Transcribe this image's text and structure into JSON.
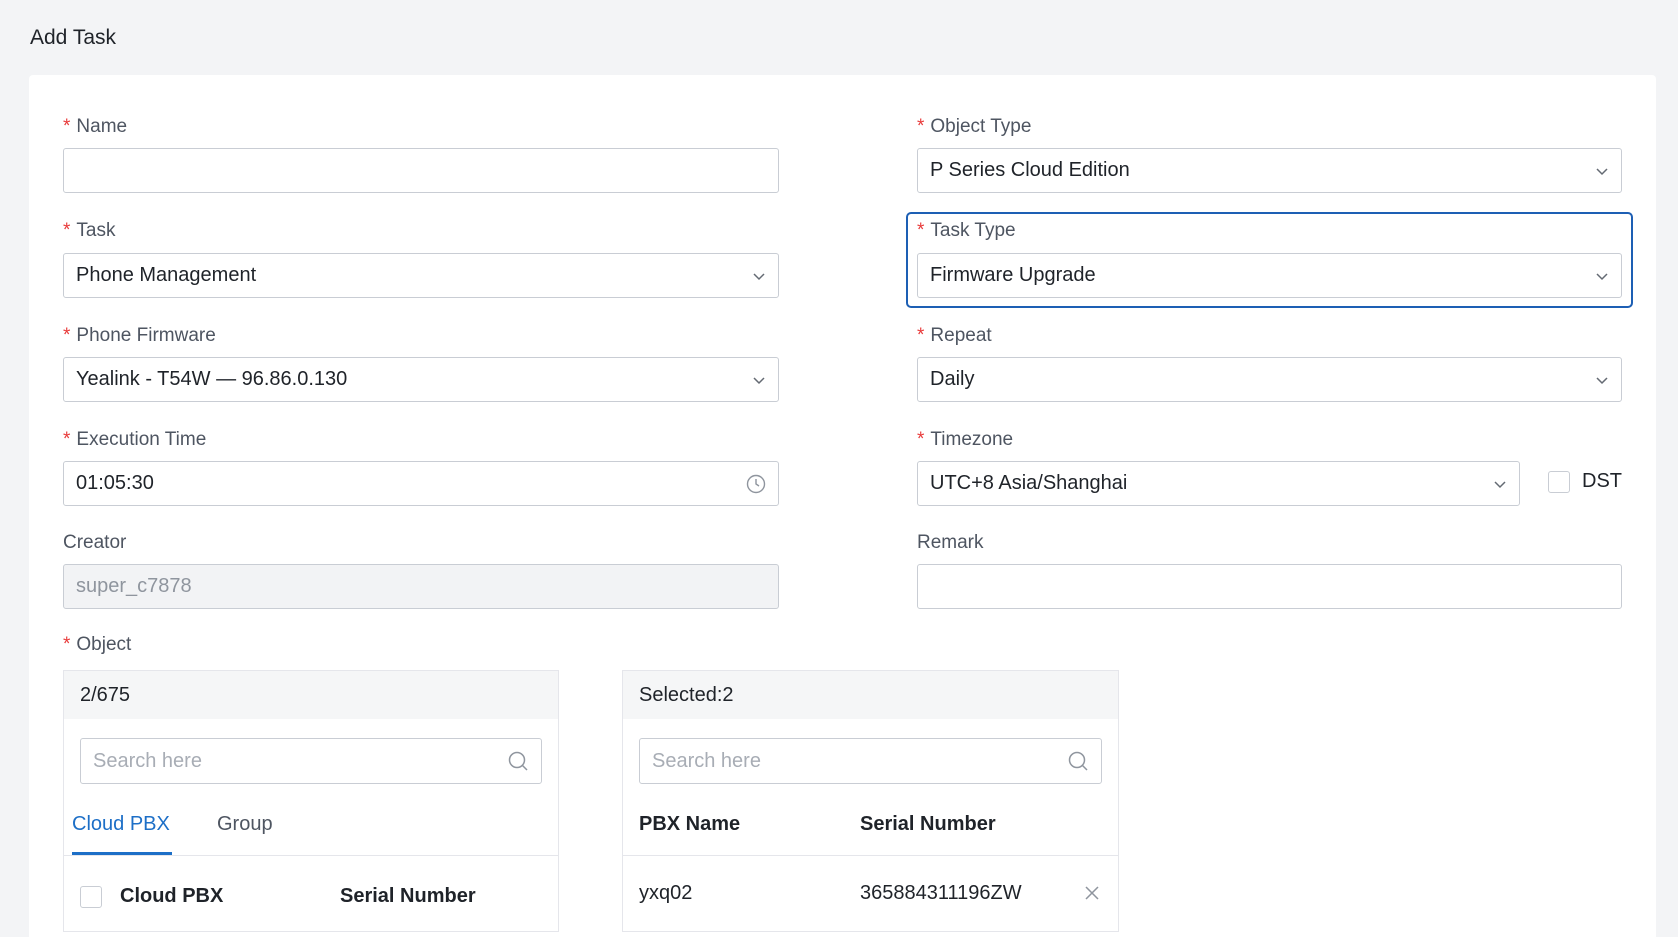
{
  "page": {
    "title": "Add Task"
  },
  "form": {
    "name": {
      "label": "Name",
      "value": ""
    },
    "object_type": {
      "label": "Object Type",
      "value": "P Series Cloud Edition"
    },
    "task": {
      "label": "Task",
      "value": "Phone Management"
    },
    "task_type": {
      "label": "Task Type",
      "value": "Firmware Upgrade"
    },
    "phone_firmware": {
      "label": "Phone Firmware",
      "value": "Yealink - T54W — 96.86.0.130"
    },
    "repeat": {
      "label": "Repeat",
      "value": "Daily"
    },
    "execution_time": {
      "label": "Execution Time",
      "value": "01:05:30"
    },
    "timezone": {
      "label": "Timezone",
      "value": "UTC+8 Asia/Shanghai"
    },
    "dst": {
      "label": "DST",
      "checked": false
    },
    "creator": {
      "label": "Creator",
      "value": "super_c7878"
    },
    "remark": {
      "label": "Remark",
      "value": ""
    },
    "object": {
      "label": "Object"
    },
    "required_mark": "*"
  },
  "source_panel": {
    "count": "2/675",
    "search_placeholder": "Search here",
    "tabs": [
      {
        "label": "Cloud PBX",
        "active": true
      },
      {
        "label": "Group",
        "active": false
      }
    ],
    "columns": [
      "Cloud PBX",
      "Serial Number"
    ]
  },
  "selected_panel": {
    "count": "Selected:2",
    "search_placeholder": "Search here",
    "columns": [
      "PBX Name",
      "Serial Number"
    ],
    "rows": [
      {
        "pbx_name": "yxq02",
        "serial": "365884311196ZW"
      }
    ]
  },
  "colors": {
    "accent": "#1d6fc7",
    "required": "#e83a3a",
    "focus": "#1d5fb4"
  }
}
